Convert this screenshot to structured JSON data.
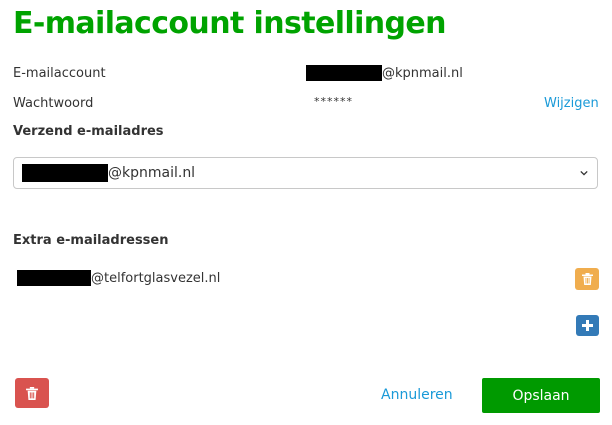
{
  "page": {
    "title": "E-mailaccount instellingen"
  },
  "account": {
    "label": "E-mailaccount",
    "email_domain": "@kpnmail.nl"
  },
  "password": {
    "label": "Wachtwoord",
    "value": "******",
    "change_link": "Wijzigen"
  },
  "sender": {
    "heading": "Verzend e-mailadres",
    "selected_domain": "@kpnmail.nl"
  },
  "extra": {
    "heading": "Extra e-mailadressen",
    "items": [
      {
        "domain": "@telfortglasvezel.nl"
      }
    ]
  },
  "actions": {
    "cancel_label": "Annuleren",
    "save_label": "Opslaan"
  },
  "colors": {
    "title_green": "#00a300",
    "link_blue": "#1a9ad8",
    "delete_orange": "#f0ad4e",
    "add_blue": "#337ab7",
    "delete_red": "#d9534f",
    "save_green": "#009a00"
  },
  "icons": {
    "row_delete": "trash-icon",
    "add_address": "plus-icon",
    "account_delete": "trash-icon",
    "select_arrow": "chevron-down-icon"
  }
}
